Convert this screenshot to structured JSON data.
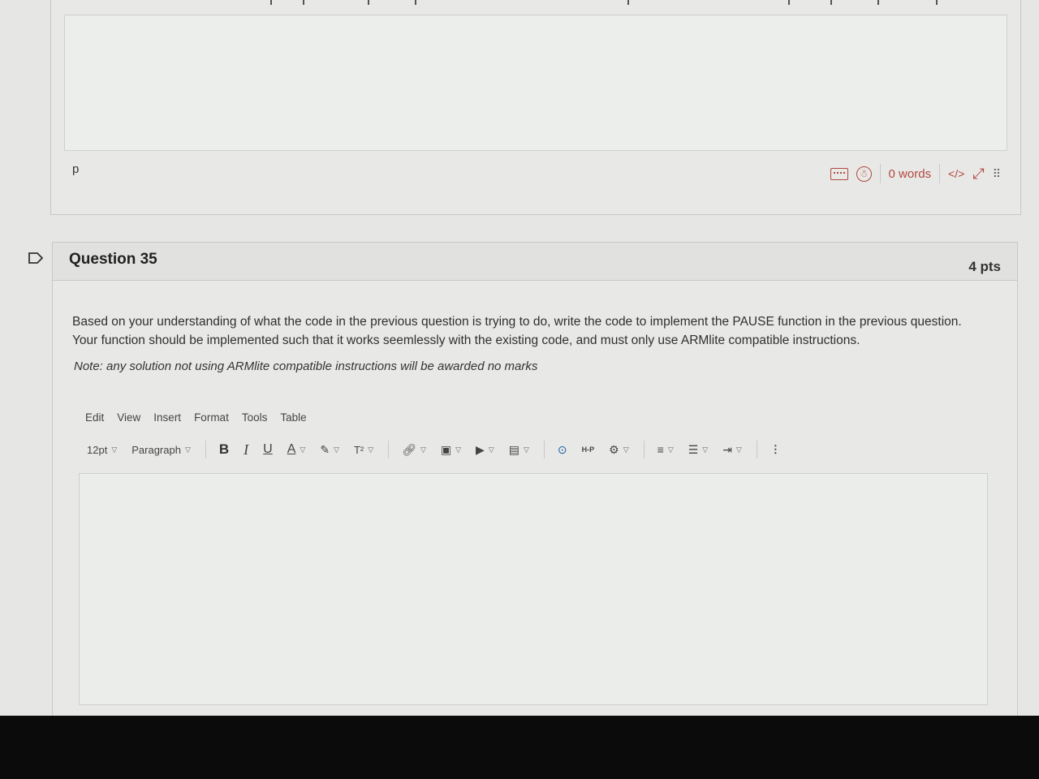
{
  "previous_editor": {
    "path_label": "p",
    "word_count": "0 words",
    "html_toggle": "</>",
    "fullscreen_icon": "⤢"
  },
  "question": {
    "name": "Question 35",
    "points": "4 pts",
    "text": "Based on your understanding of what the code in the previous question is trying to do, write the code to implement the PAUSE function in the previous question.  Your function should be implemented such that it works seemlessly with the existing code, and must only use ARMlite compatible instructions.",
    "note": "Note: any solution not using ARMlite compatible instructions will be awarded no marks"
  },
  "editor": {
    "menu": [
      "Edit",
      "View",
      "Insert",
      "Format",
      "Tools",
      "Table"
    ],
    "font_size": "12pt",
    "block_format": "Paragraph",
    "bold": "B",
    "italic": "I",
    "underline": "U",
    "text_color": "A",
    "superscript": "T²",
    "h5p": "H-P",
    "more": "⋮"
  },
  "colors": {
    "accent": "#b2473e",
    "bezel": "#0b0b0b"
  }
}
